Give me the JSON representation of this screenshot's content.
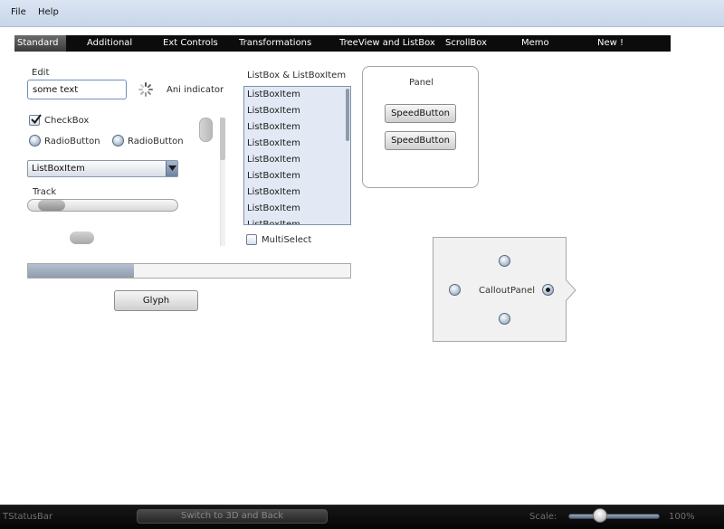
{
  "menubar": {
    "items": [
      "File",
      "Help"
    ]
  },
  "tabs": [
    {
      "label": "Standard",
      "active": true
    },
    {
      "label": "Additional"
    },
    {
      "label": "Ext Controls"
    },
    {
      "label": "Transformations"
    },
    {
      "label": "TreeView and ListBox"
    },
    {
      "label": "ScrollBox"
    },
    {
      "label": "Memo"
    },
    {
      "label": "New !"
    }
  ],
  "standard": {
    "edit_label": "Edit",
    "edit_value": "some text",
    "ani_indicator_label": "Ani indicator",
    "checkbox_label": "CheckBox",
    "checkbox_checked": true,
    "radio1_label": "RadioButton",
    "radio2_label": "RadioButton",
    "combobox_value": "ListBoxItem",
    "track_label": "Track",
    "track_value": 0.08,
    "progress_value": 0.33,
    "glyph_label": "Glyph"
  },
  "listbox": {
    "title": "ListBox & ListBoxItem",
    "items": [
      "ListBoxItem",
      "ListBoxItem",
      "ListBoxItem",
      "ListBoxItem",
      "ListBoxItem",
      "ListBoxItem",
      "ListBoxItem",
      "ListBoxItem",
      "ListBoxItem"
    ],
    "multiselect_label": "MultiSelect",
    "multiselect_checked": false
  },
  "panel": {
    "title": "Panel",
    "speed_button1": "SpeedButton",
    "speed_button2": "SpeedButton"
  },
  "callout": {
    "label": "CalloutPanel"
  },
  "statusbar": {
    "label": "TStatusBar",
    "switch_button": "Switch to 3D and Back",
    "scale_label": "Scale:",
    "scale_value": "100%"
  },
  "colors": {
    "menubar": "#d3dfef",
    "tabbar": "#0c0c0c",
    "listbox_bg": "#e2e9f4",
    "statusbar": "#101010"
  }
}
